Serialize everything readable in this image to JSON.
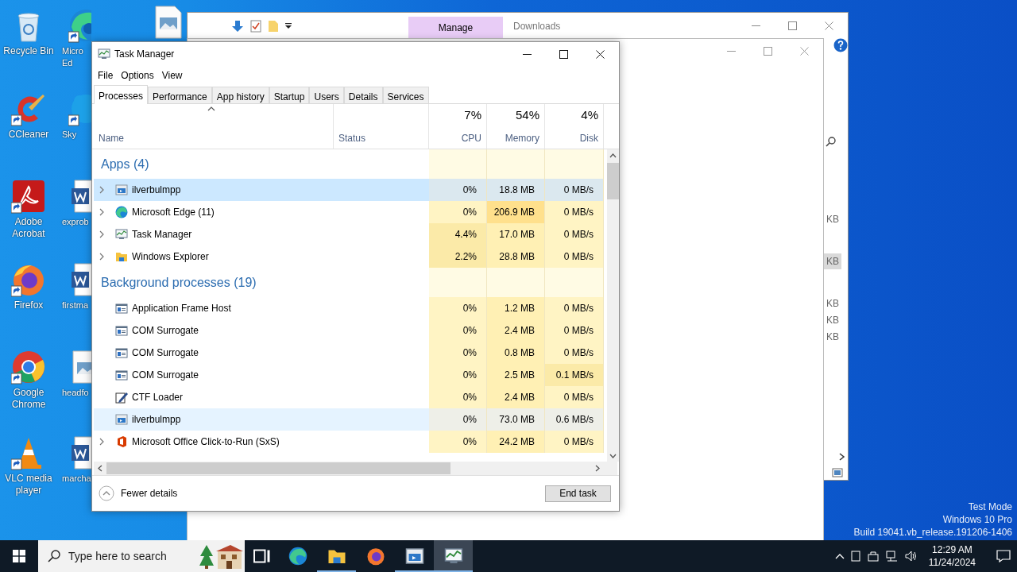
{
  "desktop_icons": [
    {
      "label": "Recycle Bin",
      "kind": "recycle",
      "shortcut": false
    },
    {
      "label": "CCleaner",
      "kind": "ccleaner",
      "shortcut": true
    },
    {
      "label": "Adobe Acrobat",
      "kind": "acrobat",
      "shortcut": true
    },
    {
      "label": "Firefox",
      "kind": "firefox",
      "shortcut": true
    },
    {
      "label": "Google Chrome",
      "kind": "chrome",
      "shortcut": true
    },
    {
      "label": "VLC media player",
      "kind": "vlc",
      "shortcut": true
    },
    {
      "label": "Micro Ed",
      "kind": "edge",
      "shortcut": true
    },
    {
      "label": "Sky",
      "kind": "skype",
      "shortcut": true
    },
    {
      "label": "exprob",
      "kind": "word",
      "shortcut": false
    },
    {
      "label": "firstma",
      "kind": "word",
      "shortcut": false
    },
    {
      "label": "headfo",
      "kind": "image",
      "shortcut": false
    },
    {
      "label": "marcha",
      "kind": "word",
      "shortcut": false
    },
    {
      "kind": "image",
      "shortcut": false
    }
  ],
  "explorer_back": {
    "ribbon_tab": "Manage",
    "title": "Downloads",
    "side_sizes": [
      "KB",
      "KB",
      "KB",
      "KB",
      "KB"
    ]
  },
  "task_manager": {
    "title": "Task Manager",
    "menu": [
      "File",
      "Options",
      "View"
    ],
    "tabs": [
      {
        "label": "Processes",
        "selected": true
      },
      {
        "label": "Performance",
        "selected": false
      },
      {
        "label": "App history",
        "selected": false
      },
      {
        "label": "Startup",
        "selected": false
      },
      {
        "label": "Users",
        "selected": false
      },
      {
        "label": "Details",
        "selected": false
      },
      {
        "label": "Services",
        "selected": false
      }
    ],
    "columns": {
      "name": "Name",
      "status": "Status",
      "metrics": [
        {
          "percent": "7%",
          "label": "CPU"
        },
        {
          "percent": "54%",
          "label": "Memory"
        },
        {
          "percent": "4%",
          "label": "Disk"
        }
      ]
    },
    "groups": [
      {
        "title": "Apps (4)",
        "rows": [
          {
            "name": "ilverbulmpp",
            "kind": "appwin",
            "expandable": true,
            "selected": true,
            "hovered": false,
            "cells": [
              {
                "text": "0%",
                "color": "#dbe8ef"
              },
              {
                "text": "18.8 MB",
                "color": "#dbe8ef"
              },
              {
                "text": "0 MB/s",
                "color": "#dbe8ef"
              }
            ]
          },
          {
            "name": "Microsoft Edge (11)",
            "kind": "edge",
            "expandable": true,
            "selected": false,
            "hovered": false,
            "cells": [
              {
                "text": "0%",
                "color": "#fff4c4"
              },
              {
                "text": "206.9 MB",
                "color": "#ffe08c"
              },
              {
                "text": "0 MB/s",
                "color": "#fff4c4"
              }
            ]
          },
          {
            "name": "Task Manager",
            "kind": "taskmgr",
            "expandable": true,
            "selected": false,
            "hovered": false,
            "cells": [
              {
                "text": "4.4%",
                "color": "#fbeaa8"
              },
              {
                "text": "17.0 MB",
                "color": "#fff0b4"
              },
              {
                "text": "0 MB/s",
                "color": "#fff4c4"
              }
            ]
          },
          {
            "name": "Windows Explorer",
            "kind": "explorer",
            "expandable": true,
            "selected": false,
            "hovered": false,
            "cells": [
              {
                "text": "2.2%",
                "color": "#fbeaa8"
              },
              {
                "text": "28.8 MB",
                "color": "#fff0b4"
              },
              {
                "text": "0 MB/s",
                "color": "#fff4c4"
              }
            ]
          }
        ]
      },
      {
        "title": "Background processes (19)",
        "rows": [
          {
            "name": "Application Frame Host",
            "kind": "frame",
            "expandable": false,
            "selected": false,
            "hovered": false,
            "cells": [
              {
                "text": "0%",
                "color": "#fff4c4"
              },
              {
                "text": "1.2 MB",
                "color": "#fff0b4"
              },
              {
                "text": "0 MB/s",
                "color": "#fff4c4"
              }
            ]
          },
          {
            "name": "COM Surrogate",
            "kind": "frame",
            "expandable": false,
            "selected": false,
            "hovered": false,
            "cells": [
              {
                "text": "0%",
                "color": "#fff4c4"
              },
              {
                "text": "2.4 MB",
                "color": "#fff0b4"
              },
              {
                "text": "0 MB/s",
                "color": "#fff4c4"
              }
            ]
          },
          {
            "name": "COM Surrogate",
            "kind": "frame",
            "expandable": false,
            "selected": false,
            "hovered": false,
            "cells": [
              {
                "text": "0%",
                "color": "#fff4c4"
              },
              {
                "text": "0.8 MB",
                "color": "#fff0b4"
              },
              {
                "text": "0 MB/s",
                "color": "#fff4c4"
              }
            ]
          },
          {
            "name": "COM Surrogate",
            "kind": "frame",
            "expandable": false,
            "selected": false,
            "hovered": false,
            "cells": [
              {
                "text": "0%",
                "color": "#fff4c4"
              },
              {
                "text": "2.5 MB",
                "color": "#fff0b4"
              },
              {
                "text": "0.1 MB/s",
                "color": "#fbeaa8"
              }
            ]
          },
          {
            "name": "CTF Loader",
            "kind": "ctf",
            "expandable": false,
            "selected": false,
            "hovered": false,
            "cells": [
              {
                "text": "0%",
                "color": "#fff4c4"
              },
              {
                "text": "2.4 MB",
                "color": "#fff0b4"
              },
              {
                "text": "0 MB/s",
                "color": "#fff4c4"
              }
            ]
          },
          {
            "name": "ilverbulmpp",
            "kind": "appwin",
            "expandable": false,
            "selected": false,
            "hovered": true,
            "cells": [
              {
                "text": "0%",
                "color": "#eeefe8"
              },
              {
                "text": "73.0 MB",
                "color": "#eeefe8"
              },
              {
                "text": "0.6 MB/s",
                "color": "#eeefe8"
              }
            ]
          },
          {
            "name": "Microsoft Office Click-to-Run (SxS)",
            "kind": "office",
            "expandable": true,
            "selected": false,
            "hovered": false,
            "cells": [
              {
                "text": "0%",
                "color": "#fff4c4"
              },
              {
                "text": "24.2 MB",
                "color": "#fff0b4"
              },
              {
                "text": "0 MB/s",
                "color": "#fff4c4"
              }
            ]
          }
        ]
      }
    ],
    "footer": {
      "fewer_details": "Fewer details",
      "end_task": "End task"
    }
  },
  "system_info": [
    "Test Mode",
    "Windows 10 Pro",
    "Build 19041.vb_release.191206-1406"
  ],
  "taskbar": {
    "search_placeholder": "Type here to search",
    "apps": [
      {
        "kind": "taskview",
        "running": false,
        "selected": false
      },
      {
        "kind": "edge",
        "running": false,
        "selected": false
      },
      {
        "kind": "explorer",
        "running": true,
        "selected": false
      },
      {
        "kind": "firefox",
        "running": false,
        "selected": false
      },
      {
        "kind": "appwin",
        "running": true,
        "selected": false
      },
      {
        "kind": "taskmgr",
        "running": true,
        "selected": true
      }
    ],
    "time": "12:29 AM",
    "date": "11/24/2024"
  }
}
